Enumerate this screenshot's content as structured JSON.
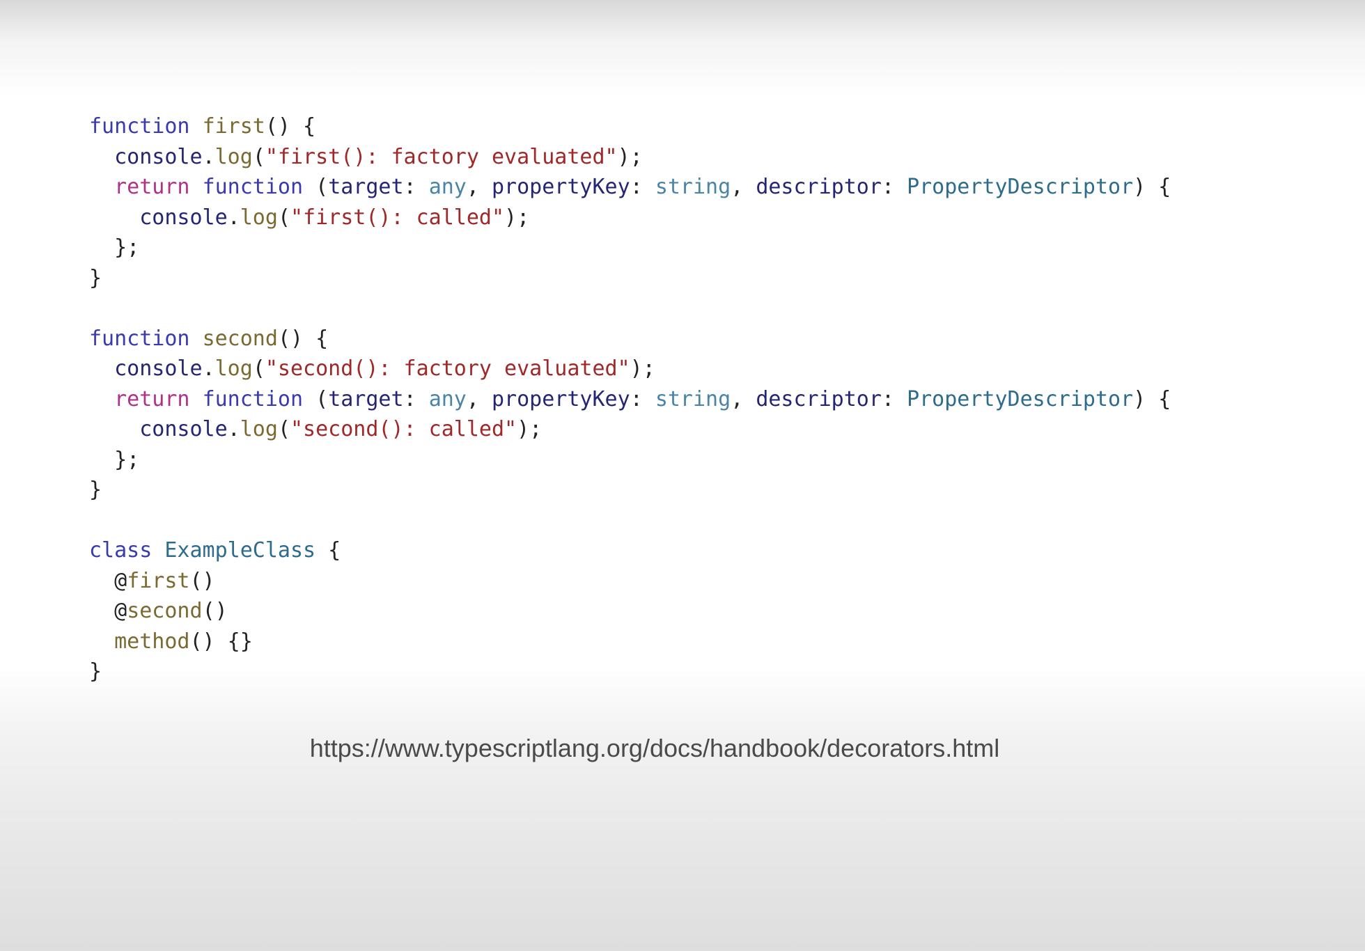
{
  "code_lines": [
    [
      [
        "kw",
        "function"
      ],
      [
        "punct",
        " "
      ],
      [
        "fn",
        "first"
      ],
      [
        "punct",
        "() {"
      ]
    ],
    [
      [
        "punct",
        "  "
      ],
      [
        "ident",
        "console"
      ],
      [
        "punct",
        "."
      ],
      [
        "fn",
        "log"
      ],
      [
        "punct",
        "("
      ],
      [
        "str",
        "\"first(): factory evaluated\""
      ],
      [
        "punct",
        ");"
      ]
    ],
    [
      [
        "punct",
        "  "
      ],
      [
        "kw2",
        "return"
      ],
      [
        "punct",
        " "
      ],
      [
        "kw",
        "function"
      ],
      [
        "punct",
        " ("
      ],
      [
        "ident",
        "target"
      ],
      [
        "punct",
        ": "
      ],
      [
        "prim",
        "any"
      ],
      [
        "punct",
        ", "
      ],
      [
        "ident",
        "propertyKey"
      ],
      [
        "punct",
        ": "
      ],
      [
        "prim",
        "string"
      ],
      [
        "punct",
        ", "
      ],
      [
        "ident",
        "descriptor"
      ],
      [
        "punct",
        ": "
      ],
      [
        "type",
        "PropertyDescriptor"
      ],
      [
        "punct",
        ") {"
      ]
    ],
    [
      [
        "punct",
        "    "
      ],
      [
        "ident",
        "console"
      ],
      [
        "punct",
        "."
      ],
      [
        "fn",
        "log"
      ],
      [
        "punct",
        "("
      ],
      [
        "str",
        "\"first(): called\""
      ],
      [
        "punct",
        ");"
      ]
    ],
    [
      [
        "punct",
        "  };"
      ]
    ],
    [
      [
        "punct",
        "}"
      ]
    ],
    [
      [
        "punct",
        ""
      ]
    ],
    [
      [
        "kw",
        "function"
      ],
      [
        "punct",
        " "
      ],
      [
        "fn",
        "second"
      ],
      [
        "punct",
        "() {"
      ]
    ],
    [
      [
        "punct",
        "  "
      ],
      [
        "ident",
        "console"
      ],
      [
        "punct",
        "."
      ],
      [
        "fn",
        "log"
      ],
      [
        "punct",
        "("
      ],
      [
        "str",
        "\"second(): factory evaluated\""
      ],
      [
        "punct",
        ");"
      ]
    ],
    [
      [
        "punct",
        "  "
      ],
      [
        "kw2",
        "return"
      ],
      [
        "punct",
        " "
      ],
      [
        "kw",
        "function"
      ],
      [
        "punct",
        " ("
      ],
      [
        "ident",
        "target"
      ],
      [
        "punct",
        ": "
      ],
      [
        "prim",
        "any"
      ],
      [
        "punct",
        ", "
      ],
      [
        "ident",
        "propertyKey"
      ],
      [
        "punct",
        ": "
      ],
      [
        "prim",
        "string"
      ],
      [
        "punct",
        ", "
      ],
      [
        "ident",
        "descriptor"
      ],
      [
        "punct",
        ": "
      ],
      [
        "type",
        "PropertyDescriptor"
      ],
      [
        "punct",
        ") {"
      ]
    ],
    [
      [
        "punct",
        "    "
      ],
      [
        "ident",
        "console"
      ],
      [
        "punct",
        "."
      ],
      [
        "fn",
        "log"
      ],
      [
        "punct",
        "("
      ],
      [
        "str",
        "\"second(): called\""
      ],
      [
        "punct",
        ");"
      ]
    ],
    [
      [
        "punct",
        "  };"
      ]
    ],
    [
      [
        "punct",
        "}"
      ]
    ],
    [
      [
        "punct",
        ""
      ]
    ],
    [
      [
        "kw",
        "class"
      ],
      [
        "punct",
        " "
      ],
      [
        "type",
        "ExampleClass"
      ],
      [
        "punct",
        " {"
      ]
    ],
    [
      [
        "punct",
        "  @"
      ],
      [
        "fn",
        "first"
      ],
      [
        "punct",
        "()"
      ]
    ],
    [
      [
        "punct",
        "  @"
      ],
      [
        "fn",
        "second"
      ],
      [
        "punct",
        "()"
      ]
    ],
    [
      [
        "punct",
        "  "
      ],
      [
        "fn",
        "method"
      ],
      [
        "punct",
        "() {}"
      ]
    ],
    [
      [
        "punct",
        "}"
      ]
    ]
  ],
  "source_url": "https://www.typescriptlang.org/docs/handbook/decorators.html",
  "colors": {
    "keyword": "#3a3ab0",
    "return_keyword": "#b0318a",
    "function_name": "#7a6a32",
    "string": "#a02828",
    "identifier": "#252575",
    "type": "#2d6c8c",
    "primitive_type": "#4a84a8"
  }
}
